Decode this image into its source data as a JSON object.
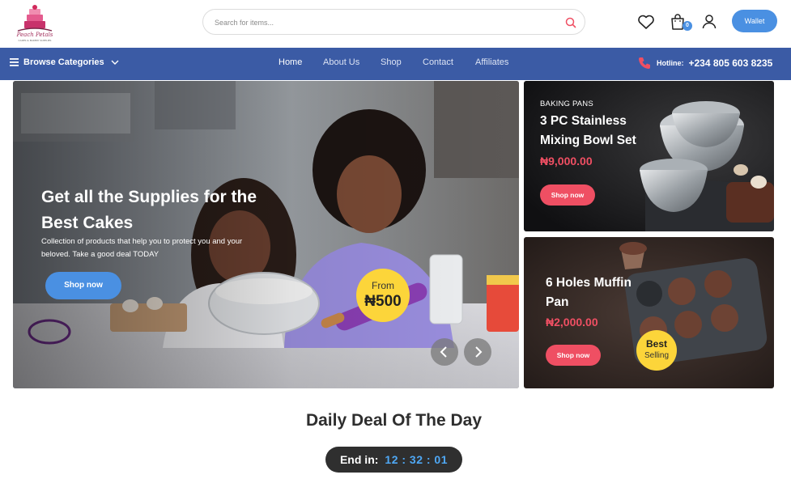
{
  "brand": {
    "name": "Peach Petals",
    "tagline": "CAKES & BAKERY SUPPLIES"
  },
  "search": {
    "placeholder": "Search for items..."
  },
  "header": {
    "cart_count": "0",
    "wallet_label": "Wallet"
  },
  "nav": {
    "browse_label": "Browse Categories",
    "links": [
      "Home",
      "About Us",
      "Shop",
      "Contact",
      "Affiliates"
    ],
    "active": "Home",
    "hotline_label": "Hotline:",
    "hotline_number": "+234 805 603 8235"
  },
  "hero": {
    "title": "Get all the Supplies for the Best Cakes",
    "subtitle": "Collection of products that help you to protect you and your beloved. Take a good deal TODAY",
    "button": "Shop now",
    "from_label": "From",
    "from_price": "₦500"
  },
  "cards": [
    {
      "category": "BAKING PANS",
      "title": "3 PC Stainless Mixing Bowl Set",
      "price": "₦9,000.00",
      "button": "Shop now"
    },
    {
      "title": "6 Holes Muffin Pan",
      "price": "₦2,000.00",
      "button": "Shop now",
      "badge_1": "Best",
      "badge_2": "Selling"
    }
  ],
  "deal": {
    "title": "Daily Deal Of The Day",
    "end_label": "End in:",
    "time": "12 : 32 : 01"
  },
  "colors": {
    "nav": "#3b5ba5",
    "accent_blue": "#4a90e2",
    "accent_pink": "#ef4f63",
    "badge_yellow": "#fcd53a"
  }
}
